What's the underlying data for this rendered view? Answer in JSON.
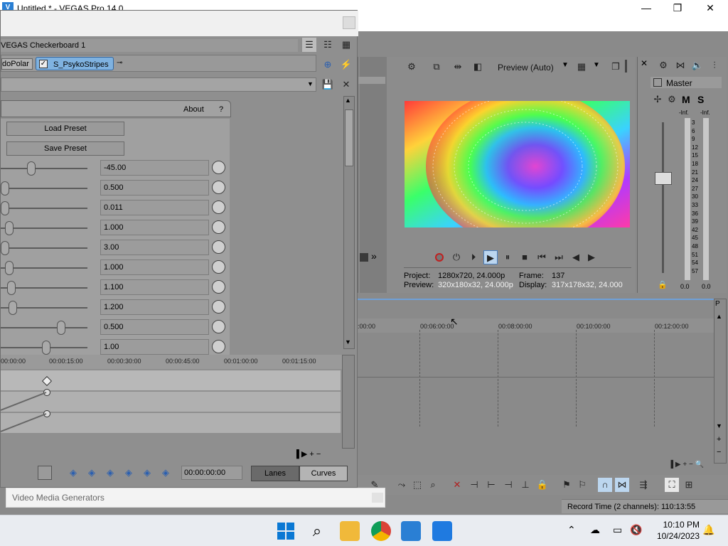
{
  "window": {
    "title": "Untitled * - VEGAS Pro 14.0",
    "logo": "V",
    "min": "—",
    "max": "❐",
    "close": "✕"
  },
  "fx": {
    "chain_title": "VEGAS Checkerboard 1",
    "plugin1": "doPolar",
    "plugin2": "S_PsykoStripes",
    "about": "About",
    "help": "?",
    "load_preset": "Load Preset",
    "save_preset": "Save Preset",
    "params": [
      {
        "value": "-45.00",
        "level": 0.34
      },
      {
        "value": "0.500",
        "level": 0.0
      },
      {
        "value": "0.011",
        "level": 0.0
      },
      {
        "value": "1.000",
        "level": 0.05
      },
      {
        "value": "3.00",
        "level": 0.0
      },
      {
        "value": "1.000",
        "level": 0.05
      },
      {
        "value": "1.100",
        "level": 0.08
      },
      {
        "value": "1.200",
        "level": 0.1
      },
      {
        "value": "0.500",
        "level": 0.72
      },
      {
        "value": "1.00",
        "level": 0.53
      }
    ],
    "timeline_ticks": [
      "00:00:00",
      "00:00:15:00",
      "00:00:30:00",
      "00:00:45:00",
      "00:01:00:00",
      "00:01:15:00"
    ],
    "timecode": "00:00:00:00",
    "lanes": "Lanes",
    "curves": "Curves",
    "generators": "Video Media Generators"
  },
  "preview": {
    "quality": "Preview (Auto)",
    "project_label": "Project:",
    "project_value": "1280x720, 24.000p",
    "preview_label": "Preview:",
    "preview_value": "320x180x32, 24.000p",
    "frame_label": "Frame:",
    "frame_value": "137",
    "display_label": "Display:",
    "display_value": "317x178x32, 24.000"
  },
  "master": {
    "title": "Master",
    "m": "M",
    "s": "S",
    "peak_l": "-Inf.",
    "peak_r": "-Inf.",
    "scale": [
      "3",
      "6",
      "9",
      "12",
      "15",
      "18",
      "21",
      "24",
      "27",
      "30",
      "33",
      "36",
      "39",
      "42",
      "45",
      "48",
      "51",
      "54",
      "57"
    ],
    "bottom_l": "0.0",
    "bottom_r": "0.0"
  },
  "timeline": {
    "ticks": [
      ":00:00",
      "00:06:00:00",
      "00:08:00:00",
      "00:10:00:00",
      "00:12:00:00"
    ]
  },
  "status": {
    "record_time": "Record Time (2 channels): 110:13:55"
  },
  "taskbar": {
    "time": "10:10 PM",
    "date": "10/24/2023"
  },
  "colors": {
    "accent": "#2a7fd4",
    "plugin_chip": "#7fb2e0"
  }
}
